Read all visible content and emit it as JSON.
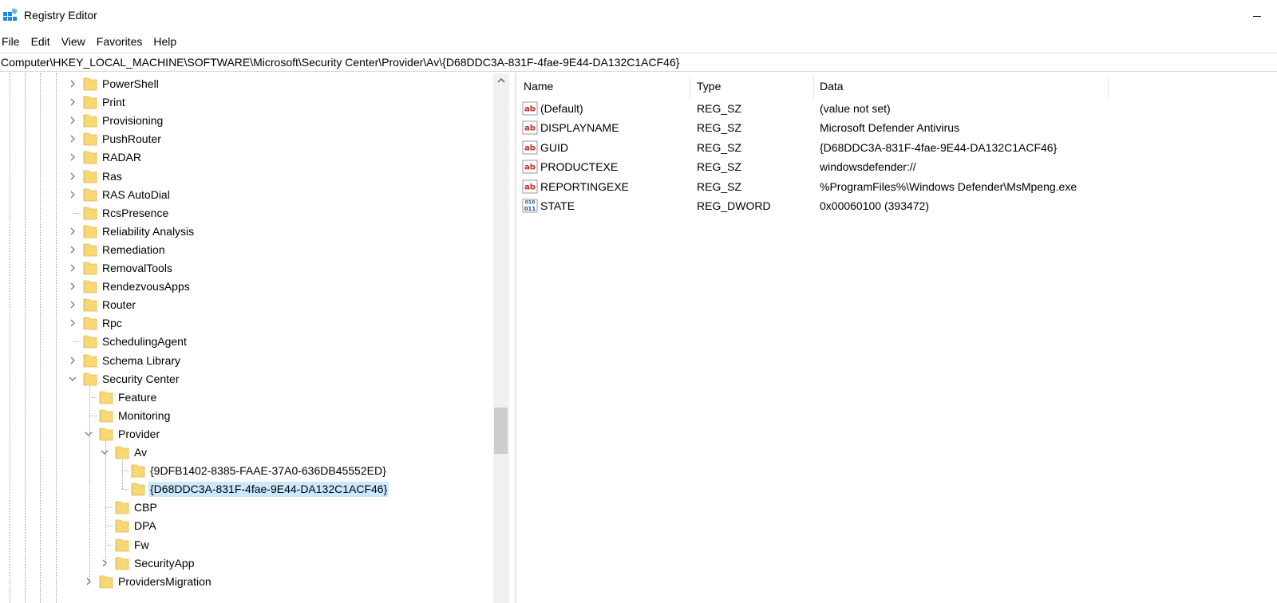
{
  "window": {
    "title": "Registry Editor"
  },
  "menu": [
    "File",
    "Edit",
    "View",
    "Favorites",
    "Help"
  ],
  "address": "Computer\\HKEY_LOCAL_MACHINE\\SOFTWARE\\Microsoft\\Security Center\\Provider\\Av\\{D68DDC3A-831F-4fae-9E44-DA132C1ACF46}",
  "tree": {
    "items": [
      {
        "label": "PowerShell",
        "depth": 0,
        "expander": "collapsed"
      },
      {
        "label": "Print",
        "depth": 0,
        "expander": "collapsed"
      },
      {
        "label": "Provisioning",
        "depth": 0,
        "expander": "collapsed"
      },
      {
        "label": "PushRouter",
        "depth": 0,
        "expander": "collapsed"
      },
      {
        "label": "RADAR",
        "depth": 0,
        "expander": "collapsed"
      },
      {
        "label": "Ras",
        "depth": 0,
        "expander": "collapsed"
      },
      {
        "label": "RAS AutoDial",
        "depth": 0,
        "expander": "collapsed"
      },
      {
        "label": "RcsPresence",
        "depth": 0,
        "expander": "none"
      },
      {
        "label": "Reliability Analysis",
        "depth": 0,
        "expander": "collapsed"
      },
      {
        "label": "Remediation",
        "depth": 0,
        "expander": "collapsed"
      },
      {
        "label": "RemovalTools",
        "depth": 0,
        "expander": "collapsed"
      },
      {
        "label": "RendezvousApps",
        "depth": 0,
        "expander": "collapsed"
      },
      {
        "label": "Router",
        "depth": 0,
        "expander": "collapsed"
      },
      {
        "label": "Rpc",
        "depth": 0,
        "expander": "collapsed"
      },
      {
        "label": "SchedulingAgent",
        "depth": 0,
        "expander": "none"
      },
      {
        "label": "Schema Library",
        "depth": 0,
        "expander": "collapsed"
      },
      {
        "label": "Security Center",
        "depth": 0,
        "expander": "expanded"
      },
      {
        "label": "Feature",
        "depth": 1,
        "expander": "none"
      },
      {
        "label": "Monitoring",
        "depth": 1,
        "expander": "none"
      },
      {
        "label": "Provider",
        "depth": 1,
        "expander": "expanded"
      },
      {
        "label": "Av",
        "depth": 2,
        "expander": "expanded"
      },
      {
        "label": "{9DFB1402-8385-FAAE-37A0-636DB45552ED}",
        "depth": 3,
        "expander": "none"
      },
      {
        "label": "{D68DDC3A-831F-4fae-9E44-DA132C1ACF46}",
        "depth": 3,
        "expander": "none",
        "selected": true
      },
      {
        "label": "CBP",
        "depth": 2,
        "expander": "none"
      },
      {
        "label": "DPA",
        "depth": 2,
        "expander": "none"
      },
      {
        "label": "Fw",
        "depth": 2,
        "expander": "none"
      },
      {
        "label": "SecurityApp",
        "depth": 2,
        "expander": "collapsed"
      },
      {
        "label": "ProvidersMigration",
        "depth": 1,
        "expander": "collapsed"
      }
    ]
  },
  "values": {
    "columns": {
      "name": "Name",
      "type": "Type",
      "data": "Data"
    },
    "rows": [
      {
        "icon": "string-value-icon",
        "name": "(Default)",
        "type": "REG_SZ",
        "data": "(value not set)"
      },
      {
        "icon": "string-value-icon",
        "name": "DISPLAYNAME",
        "type": "REG_SZ",
        "data": "Microsoft Defender Antivirus"
      },
      {
        "icon": "string-value-icon",
        "name": "GUID",
        "type": "REG_SZ",
        "data": "{D68DDC3A-831F-4fae-9E44-DA132C1ACF46}"
      },
      {
        "icon": "string-value-icon",
        "name": "PRODUCTEXE",
        "type": "REG_SZ",
        "data": "windowsdefender://"
      },
      {
        "icon": "string-value-icon",
        "name": "REPORTINGEXE",
        "type": "REG_SZ",
        "data": "%ProgramFiles%\\Windows Defender\\MsMpeng.exe"
      },
      {
        "icon": "dword-value-icon",
        "name": "STATE",
        "type": "REG_DWORD",
        "data": "0x00060100 (393472)"
      }
    ]
  },
  "colors": {
    "folder": "#f8d775",
    "folder_edge": "#e0b84c",
    "selection": "#cce8ff",
    "string_icon": "#c42b1c",
    "dword_icon": "#1a4fa3"
  }
}
